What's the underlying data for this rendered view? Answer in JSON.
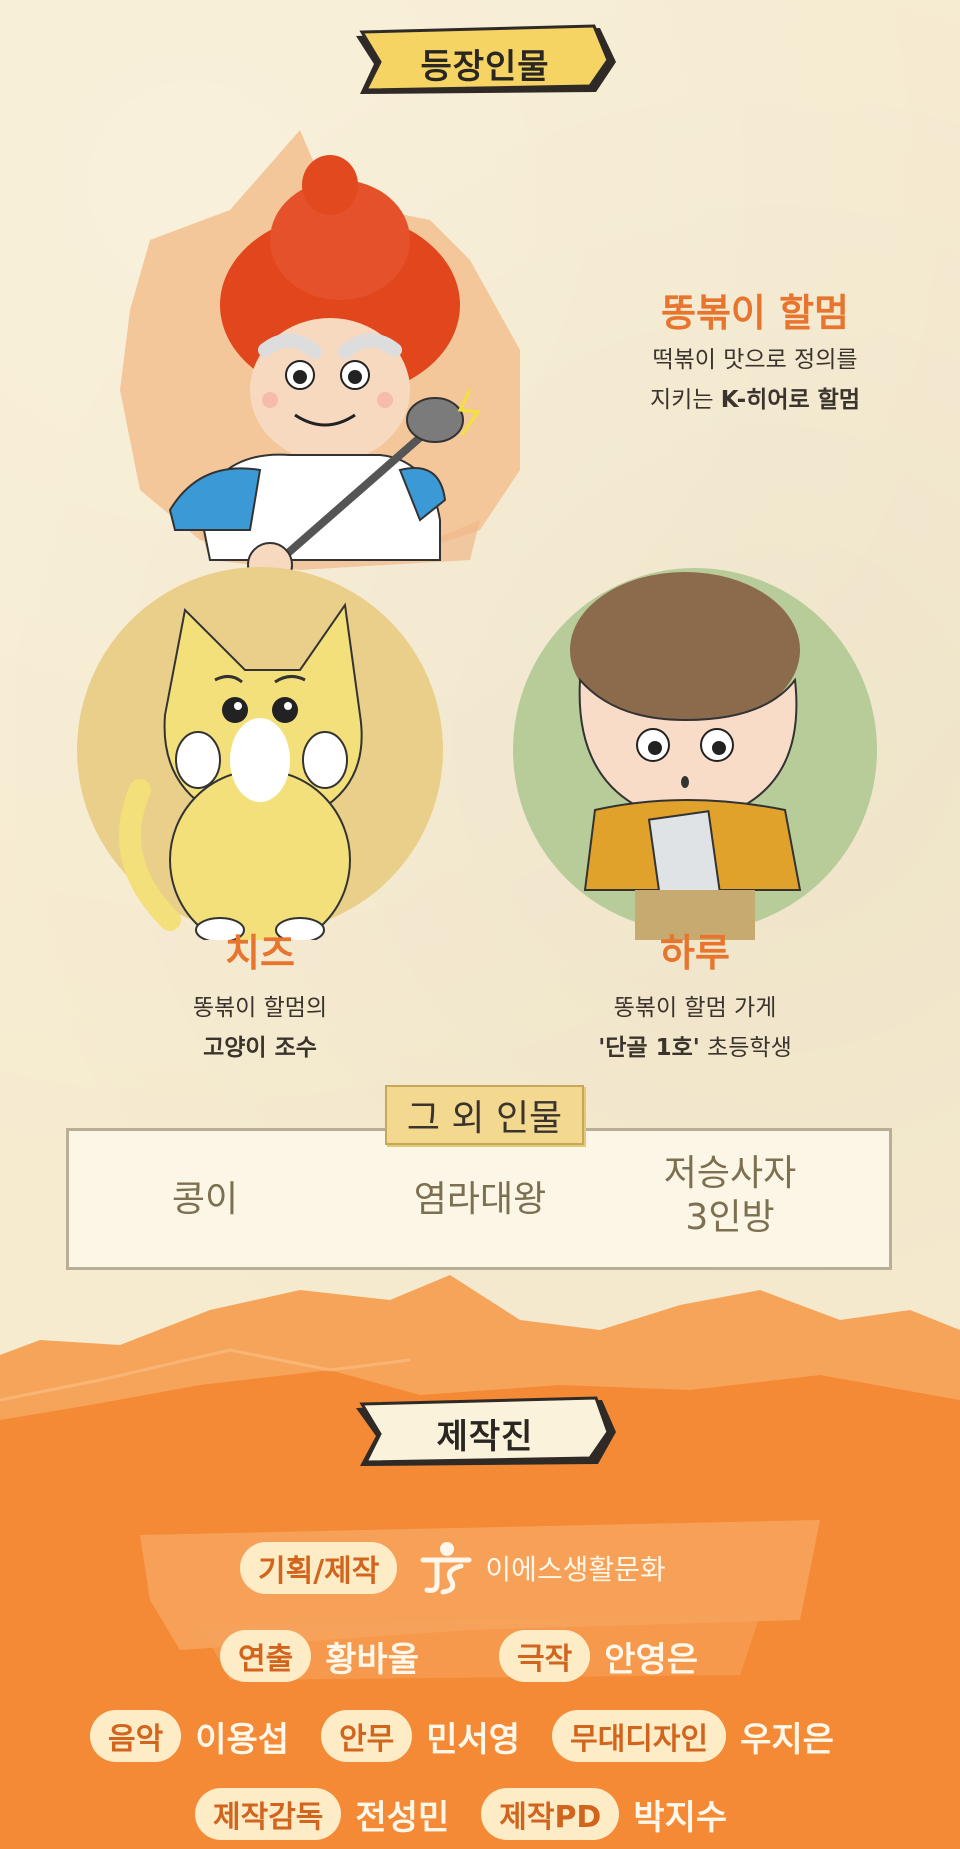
{
  "header": {
    "title": "등장인물"
  },
  "characters": [
    {
      "name": "똥볶이 할멈",
      "desc_line1": "떡볶이 맛으로 정의를",
      "desc_line2_plain": "지키는 ",
      "desc_line2_bold": "K-히어로 할멈"
    },
    {
      "name": "치즈",
      "desc_line1": "똥볶이 할멈의",
      "desc_line2": "고양이 조수"
    },
    {
      "name": "하루",
      "desc_line1": "똥볶이 할멈 가게",
      "desc_line2_bold": "'단골 1호'",
      "desc_line2_plain": " 초등학생"
    }
  ],
  "others": {
    "title": "그 외 인물",
    "items": [
      "콩이",
      "염라대왕",
      "저승사자",
      "3인방"
    ]
  },
  "staff": {
    "title": "제작진",
    "planning_role": "기획/제작",
    "company": "이에스생활문화",
    "rows": [
      [
        {
          "role": "연출",
          "name": "황바울"
        },
        {
          "role": "극작",
          "name": "안영은"
        }
      ],
      [
        {
          "role": "음악",
          "name": "이용섭"
        },
        {
          "role": "안무",
          "name": "민서영"
        },
        {
          "role": "무대디자인",
          "name": "우지은"
        }
      ],
      [
        {
          "role": "제작감독",
          "name": "전성민"
        },
        {
          "role": "제작PD",
          "name": "박지수"
        }
      ]
    ]
  },
  "colors": {
    "accent": "#e8752e",
    "background": "#f6ebcf",
    "staff_bg": "#f48a36",
    "banner": "#f5d463"
  }
}
